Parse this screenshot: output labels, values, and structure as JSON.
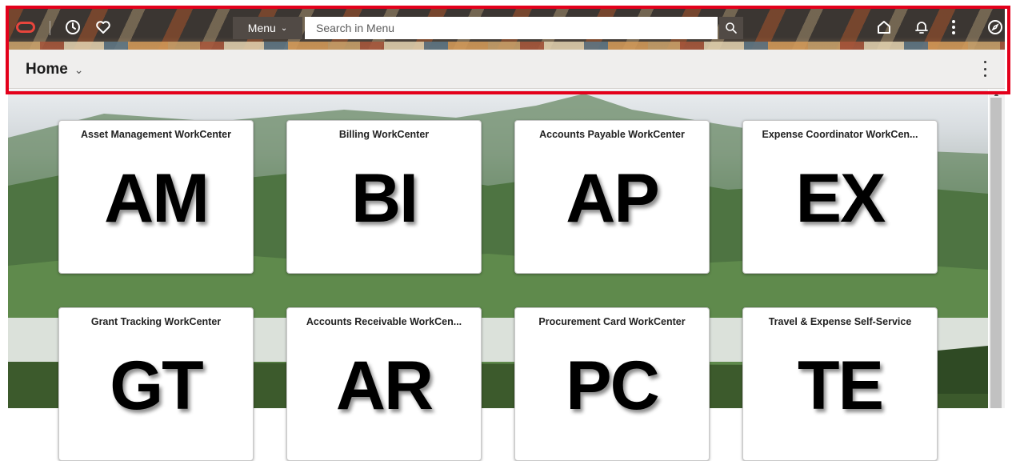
{
  "header": {
    "menu_label": "Menu",
    "search_placeholder": "Search in Menu",
    "icons": [
      "oracle-logo",
      "recent-places-icon",
      "favorites-icon",
      "home-icon",
      "notifications-icon",
      "actions-kebab-icon",
      "navigator-compass-icon"
    ]
  },
  "page": {
    "title": "Home"
  },
  "tiles": [
    {
      "title": "Asset Management WorkCenter",
      "abbr": "AM"
    },
    {
      "title": "Billing WorkCenter",
      "abbr": "BI"
    },
    {
      "title": "Accounts Payable WorkCenter",
      "abbr": "AP"
    },
    {
      "title": "Expense Coordinator WorkCen...",
      "abbr": "EX"
    },
    {
      "title": "Grant Tracking WorkCenter",
      "abbr": "GT"
    },
    {
      "title": "Accounts Receivable WorkCen...",
      "abbr": "AR"
    },
    {
      "title": "Procurement Card WorkCenter",
      "abbr": "PC"
    },
    {
      "title": "Travel & Expense Self-Service",
      "abbr": "TE"
    }
  ],
  "colors": {
    "highlight": "#e3001b",
    "oracle_red": "#e8453c",
    "header_dark": "#3b3632",
    "titlebar_bg": "#efeeed"
  }
}
